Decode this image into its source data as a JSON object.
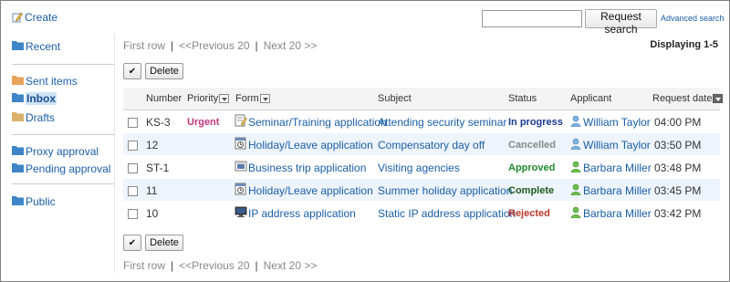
{
  "header": {
    "create_label": "Create",
    "search_placeholder": "",
    "search_button": "Request search",
    "advanced_search": "Advanced search"
  },
  "sidebar": {
    "items": [
      {
        "label": "Recent",
        "color": "#3d85c6"
      },
      {
        "label": "Sent items",
        "color": "#e8a35a"
      },
      {
        "label": "Inbox",
        "color": "#3d85c6"
      },
      {
        "label": "Drafts",
        "color": "#d9b36a"
      },
      {
        "label": "Proxy approval",
        "color": "#3d85c6"
      },
      {
        "label": "Pending approval",
        "color": "#3d85c6"
      },
      {
        "label": "Public",
        "color": "#3d85c6"
      }
    ],
    "active": "Inbox"
  },
  "pager": {
    "first": "First row",
    "prev": "<<Previous 20",
    "next": "Next 20 >>",
    "sep": "|",
    "displaying": "Displaying 1-5"
  },
  "actions": {
    "check_all": "✔",
    "delete": "Delete"
  },
  "table": {
    "columns": {
      "number": "Number",
      "priority": "Priority",
      "form": "Form",
      "subject": "Subject",
      "status": "Status",
      "applicant": "Applicant",
      "request_date": "Request date"
    },
    "rows": [
      {
        "number": "KS-3",
        "priority": "Urgent",
        "form": "Seminar/Training application",
        "form_icon": "document-pencil-icon",
        "subject": "Attending security seminar",
        "status": "In progress",
        "status_color": "#1a3a8f",
        "applicant": "William Taylor",
        "applicant_icon": "user-blue-icon",
        "date": "04:00 PM"
      },
      {
        "number": "12",
        "priority": "",
        "form": "Holiday/Leave application",
        "form_icon": "calendar-clock-icon",
        "subject": "Compensatory day off",
        "status": "Cancelled",
        "status_color": "#888888",
        "applicant": "William Taylor",
        "applicant_icon": "user-blue-icon",
        "date": "03:50 PM"
      },
      {
        "number": "ST-1",
        "priority": "",
        "form": "Business trip application",
        "form_icon": "briefcase-form-icon",
        "subject": "Visiting agencies",
        "status": "Approved",
        "status_color": "#1f8a2e",
        "applicant": "Barbara Miller",
        "applicant_icon": "user-green-icon",
        "date": "03:48 PM"
      },
      {
        "number": "11",
        "priority": "",
        "form": "Holiday/Leave application",
        "form_icon": "calendar-clock-icon",
        "subject": "Summer holiday application",
        "status": "Complete",
        "status_color": "#1e5c1e",
        "applicant": "Barbara Miller",
        "applicant_icon": "user-green-icon",
        "date": "03:45 PM"
      },
      {
        "number": "10",
        "priority": "",
        "form": "IP address application",
        "form_icon": "monitor-icon",
        "subject": "Static IP address application",
        "status": "Rejected",
        "status_color": "#c0392b",
        "applicant": "Barbara Miller",
        "applicant_icon": "user-green-icon",
        "date": "03:42 PM"
      }
    ]
  }
}
